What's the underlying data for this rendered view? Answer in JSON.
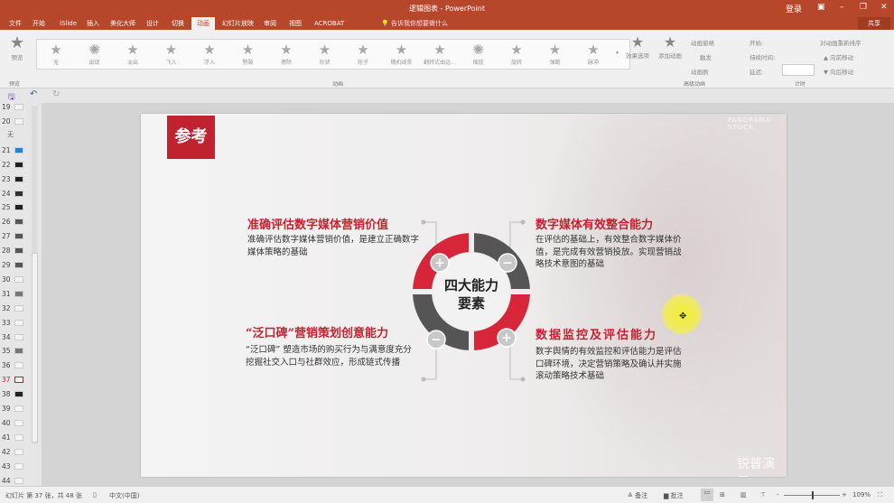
{
  "window": {
    "title": "逻辑图表 - PowerPoint",
    "login": "登录",
    "share": "共享"
  },
  "tabs": [
    "文件",
    "开始",
    "iSlide",
    "插入",
    "美化大师",
    "设计",
    "切换",
    "动画",
    "幻灯片放映",
    "审阅",
    "视图",
    "ACROBAT"
  ],
  "active_tab": "动画",
  "tell_me": "告诉我你想要做什么",
  "ribbon": {
    "preview": "预览",
    "preview_group": "预览",
    "animations": [
      "无",
      "出现",
      "淡出",
      "飞入",
      "浮入",
      "劈裂",
      "擦除",
      "形状",
      "轮子",
      "随机线条",
      "翻转式由远...",
      "缩放",
      "旋转",
      "弹跳",
      "脉冲"
    ],
    "effect_options": "效果选项",
    "animation_group": "动画",
    "add_animation": "添加动画",
    "animation_pane": "动画窗格",
    "trigger": "触发",
    "animation_painter": "动画刷",
    "advanced_group": "高级动画",
    "start": "开始:",
    "duration": "持续时间:",
    "delay": "延迟:",
    "reorder": "对动画重新排序",
    "move_earlier": "▲ 向前移动",
    "move_later": "▼ 向后移动",
    "timing_group": "计时"
  },
  "thumbnails": [
    "19",
    "20",
    "21",
    "22",
    "23",
    "24",
    "25",
    "26",
    "27",
    "28",
    "29",
    "30",
    "31",
    "32",
    "33",
    "34",
    "35",
    "36",
    "37",
    "38",
    "39",
    "40",
    "41",
    "42",
    "43",
    "44"
  ],
  "section_label": "无",
  "selected_slide": "37",
  "slide": {
    "badge": "参考",
    "center": [
      "四大能力",
      "要素"
    ],
    "watermark_top": "PANORAMA STOCK",
    "watermark_bottom": "锐普演示",
    "blocks": [
      {
        "title": "准确评估数字媒体营销价值",
        "body": "准确评估数字媒体营销价值，是建立正确数字媒体策略的基础"
      },
      {
        "title": "数字媒体有效整合能力",
        "body": "在评估的基础上，有效整合数字媒体价值，是完成有效营销投放。实现营销战略技术意图的基础"
      },
      {
        "title": "“泛口碑”营销策划创意能力",
        "body": "“泛口碑” 塑造市场的购买行为与满意度充分挖掘社交入口与社群效应，形成链式传播"
      },
      {
        "title": "数据监控及评估能力",
        "body": "数字舆情的有效监控和评估能力是评估口碑环境，决定营销策略及确认并实施滚动策略技术基础"
      }
    ],
    "ring_colors": {
      "red": "#d7253a",
      "gray": "#555555"
    }
  },
  "status": {
    "slide_info": "幻灯片 第 37 张，共 48 张",
    "language": "中文(中国)",
    "notes": "备注",
    "comments": "批注",
    "zoom": "109%"
  },
  "colors": {
    "brand": "#b7472a",
    "accent": "#c8202f"
  }
}
